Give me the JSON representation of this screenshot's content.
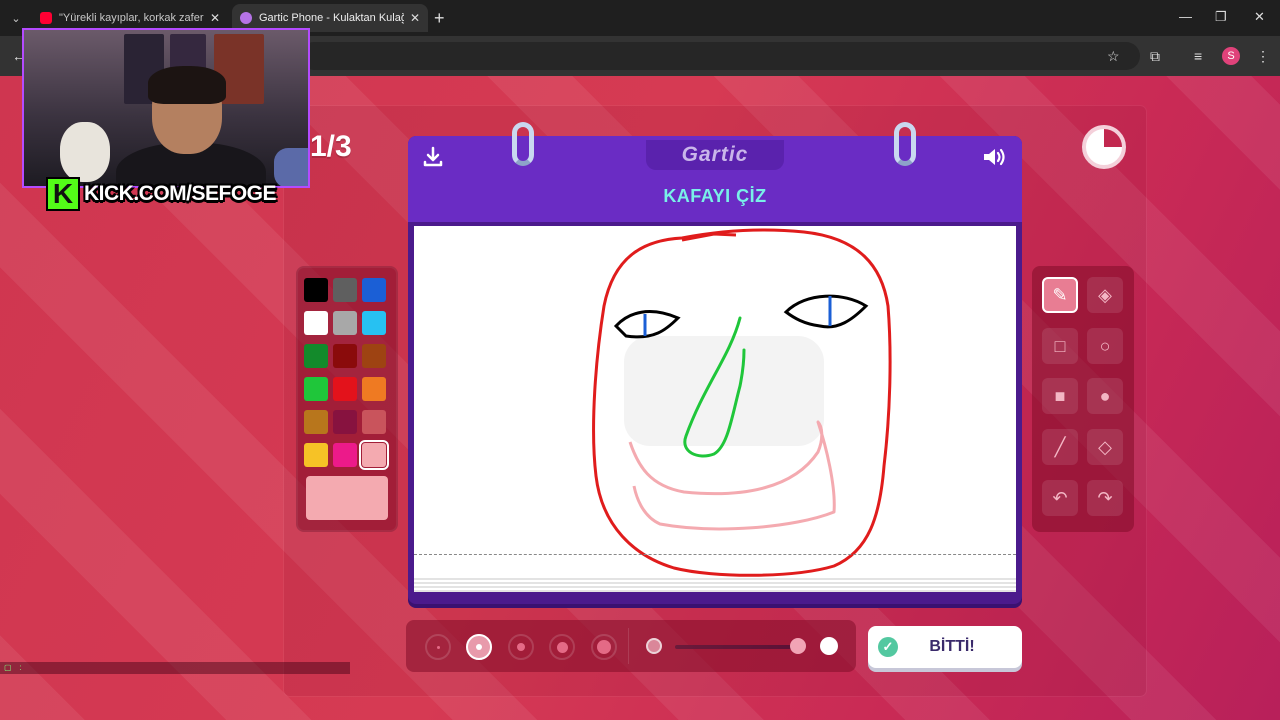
{
  "browser": {
    "tabs": [
      {
        "title": "\"Yürekli kayıplar, korkak zaferle",
        "favicon": "youtube-icon",
        "active": false
      },
      {
        "title": "Gartic Phone - Kulaktan Kulağa",
        "favicon": "gartic-icon",
        "active": true
      }
    ],
    "new_tab": "+",
    "window_controls": [
      "—",
      "❐",
      "✕"
    ],
    "profile_initial": "S"
  },
  "overlay": {
    "kick_logo_letter": "K",
    "kick_text": "KICK.COM/SEFOGE",
    "chat_line": "▢    :  "
  },
  "game": {
    "round_counter": "1/3",
    "timer_remaining_fraction": 0.75,
    "logo_text": "Gartic",
    "prompt": "KAFAYI ÇİZ",
    "download_icon": "download-icon",
    "sound_icon": "speaker-icon",
    "done_button": "BİTTİ!"
  },
  "palette": {
    "colors": [
      "#000000",
      "#5f5f5f",
      "#1b5fd6",
      "#ffffff",
      "#a8a8a8",
      "#27c1f2",
      "#138a2b",
      "#8a0b0b",
      "#9e4312",
      "#1fc63a",
      "#e3121b",
      "#ef7a22",
      "#b8761c",
      "#87123f",
      "#c9545c",
      "#f6c226",
      "#ec1a8a",
      "#f4aab0"
    ],
    "selected_index": 17,
    "current_color": "#f4aab0"
  },
  "tools": [
    {
      "name": "pencil-tool",
      "glyph": "✎",
      "active": true
    },
    {
      "name": "eraser-tool",
      "glyph": "◈",
      "active": false
    },
    {
      "name": "rectangle-outline-tool",
      "glyph": "□",
      "active": false
    },
    {
      "name": "ellipse-outline-tool",
      "glyph": "○",
      "active": false
    },
    {
      "name": "rectangle-fill-tool",
      "glyph": "■",
      "active": false
    },
    {
      "name": "ellipse-fill-tool",
      "glyph": "●",
      "active": false
    },
    {
      "name": "line-tool",
      "glyph": "╱",
      "active": false
    },
    {
      "name": "fill-bucket-tool",
      "glyph": "◇",
      "active": false
    },
    {
      "name": "undo-tool",
      "glyph": "↶",
      "active": false
    },
    {
      "name": "redo-tool",
      "glyph": "↷",
      "active": false
    }
  ],
  "brush_sizes": {
    "count": 5,
    "selected_index": 1
  },
  "opacity": {
    "value_fraction": 0.96
  }
}
